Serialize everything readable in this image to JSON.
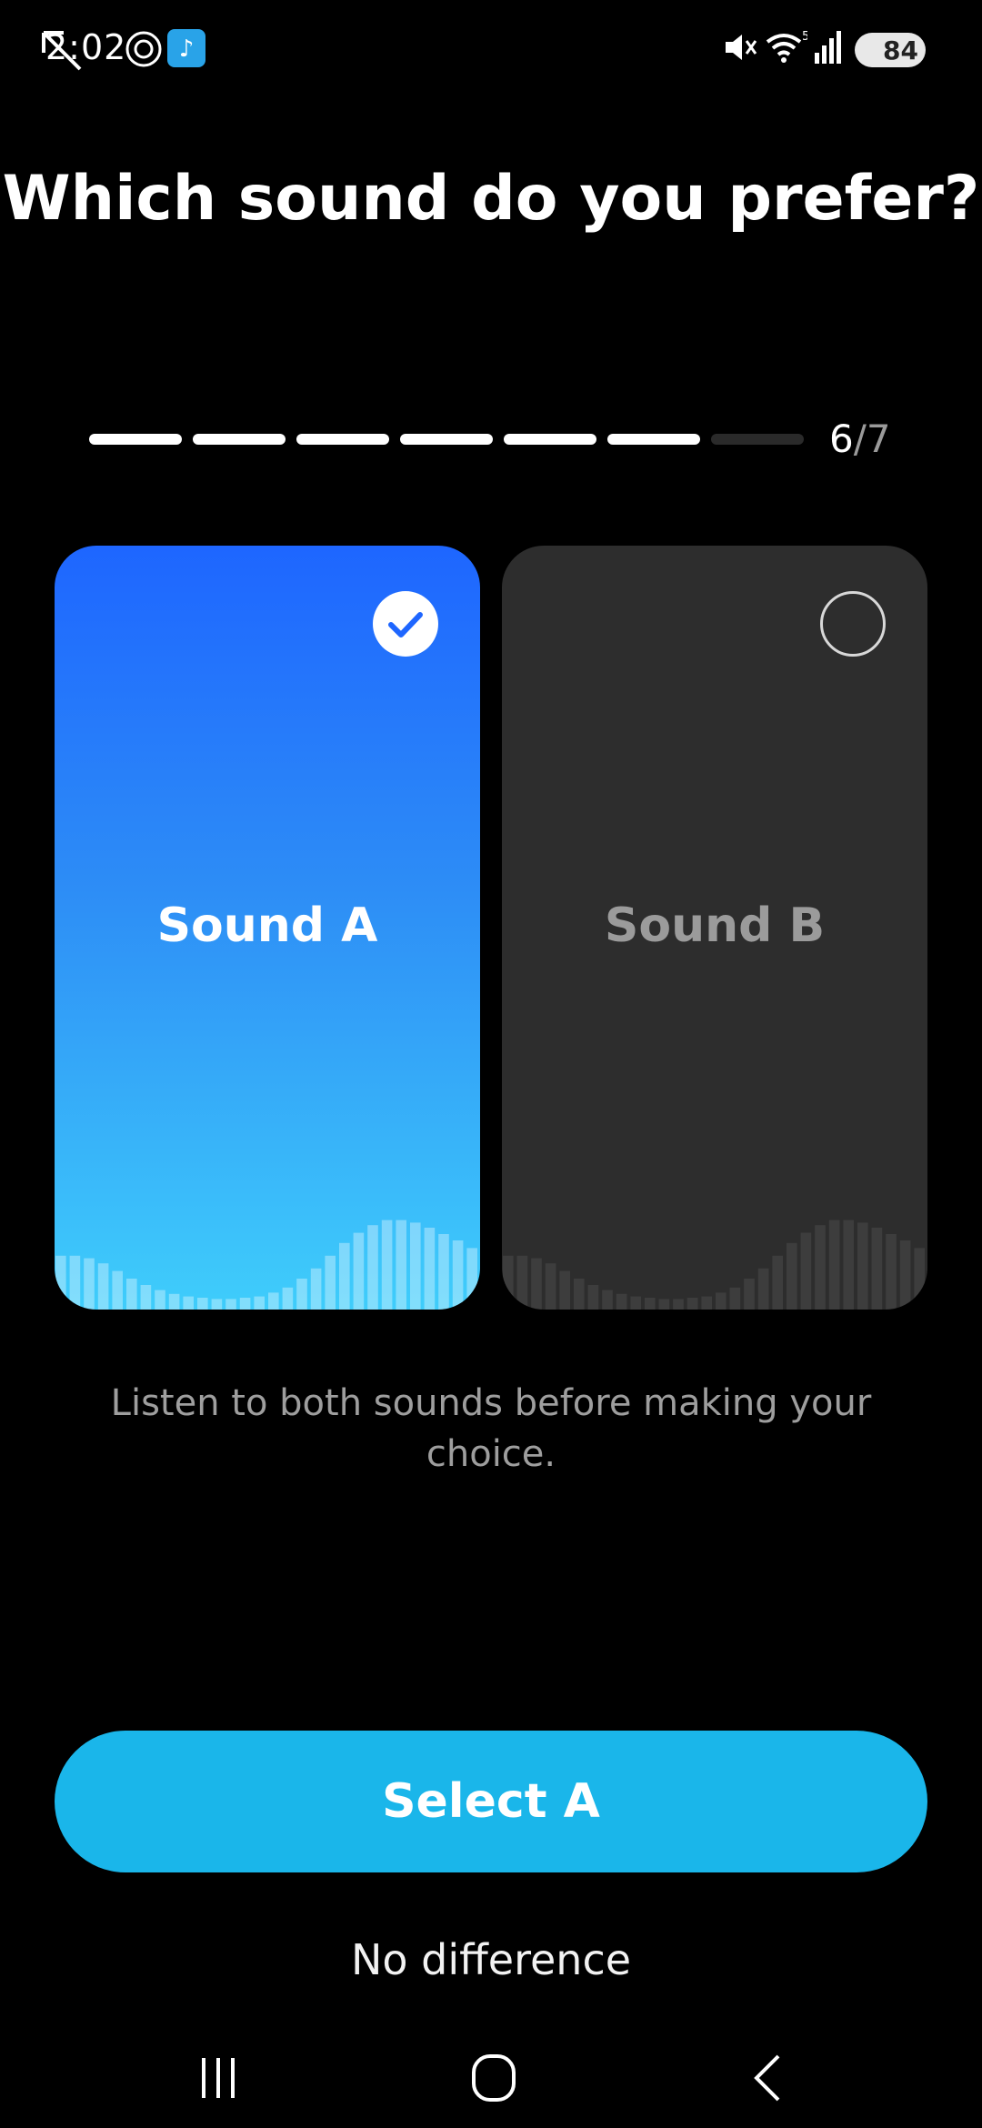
{
  "status_bar": {
    "time": "2:02",
    "battery": "84",
    "icons": [
      "back-arrow-icon",
      "at-sign-icon",
      "app-notification-icon",
      "mute-icon",
      "wifi-icon",
      "signal-icon",
      "battery-icon"
    ]
  },
  "title": "Which sound do you prefer?",
  "progress": {
    "current": "6",
    "separator": "/",
    "total": "7",
    "filled_segments": 6,
    "segment_count": 7
  },
  "options": [
    {
      "label": "Sound A",
      "selected": true,
      "color": "#1e66ff"
    },
    {
      "label": "Sound B",
      "selected": false,
      "color": "#2d2d2d"
    }
  ],
  "hint": "Listen to both sounds before making your choice.",
  "primary_button": "Select A",
  "secondary_button": "No difference",
  "colors": {
    "accent": "#1ab6ea",
    "background": "#000000"
  },
  "nav_bar": [
    "recents-icon",
    "home-icon",
    "back-icon"
  ]
}
